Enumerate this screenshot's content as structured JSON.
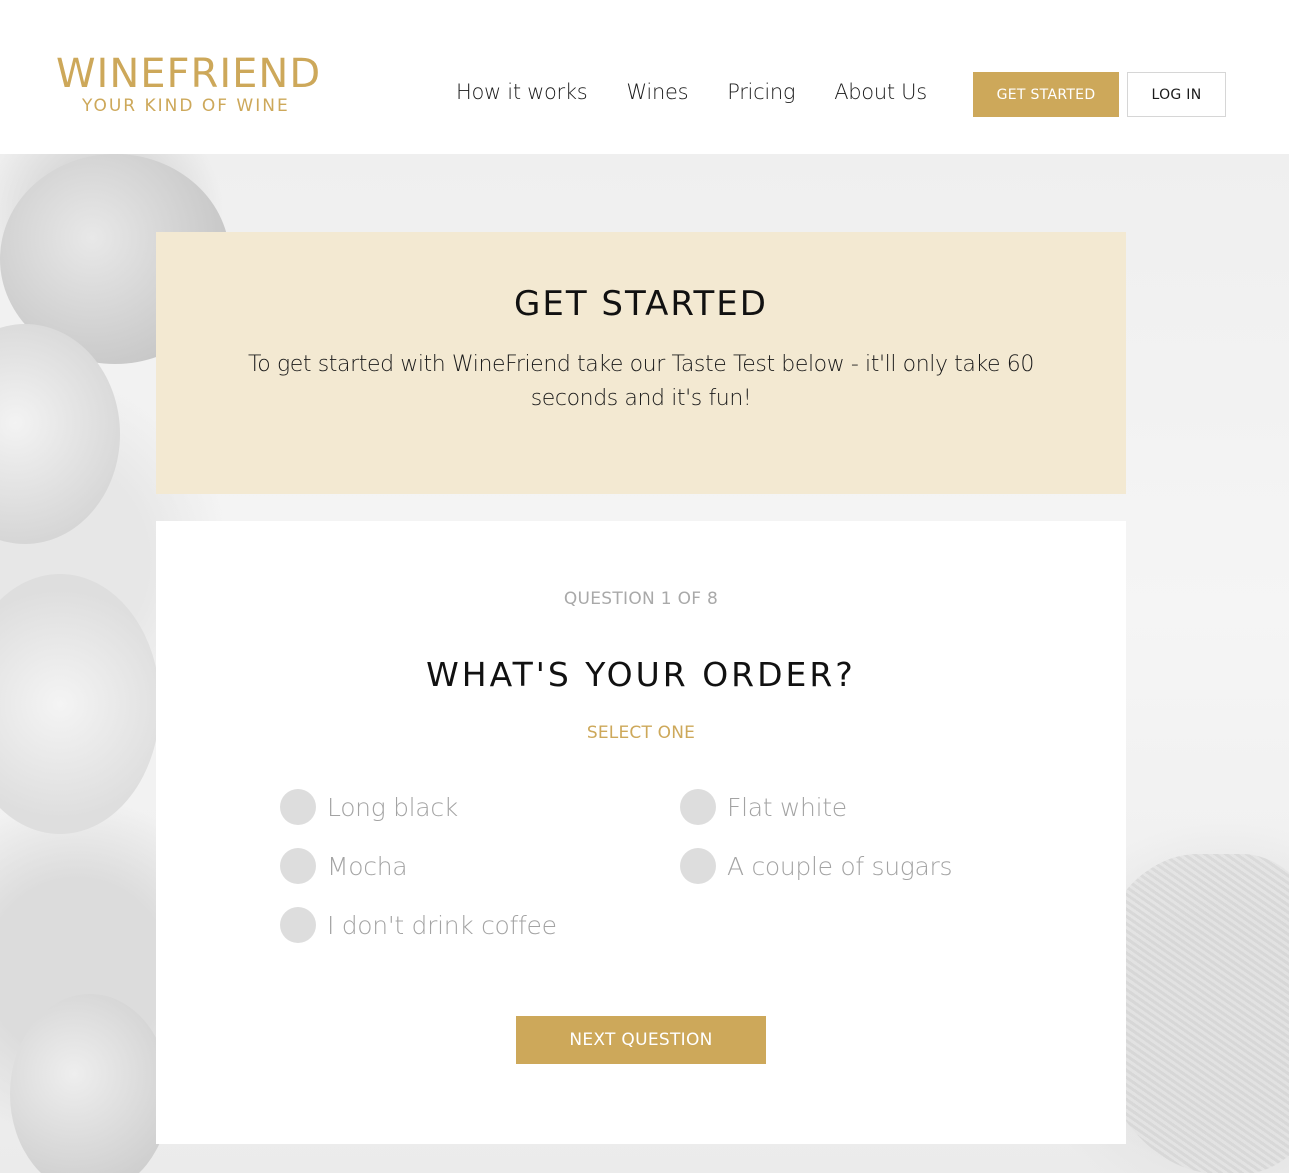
{
  "brand": {
    "name": "WINEFRIEND",
    "tagline": "YOUR KIND OF WINE",
    "accent_color": "#cda85a",
    "banner_color": "#f3e9d2"
  },
  "nav": {
    "items": [
      {
        "label": "How it works"
      },
      {
        "label": "Wines"
      },
      {
        "label": "Pricing"
      },
      {
        "label": "About Us"
      }
    ],
    "get_started_label": "GET STARTED",
    "login_label": "LOG IN"
  },
  "banner": {
    "title": "GET STARTED",
    "text": "To get started with WineFriend take our Taste Test below - it'll only take 60 seconds and it's fun!"
  },
  "quiz": {
    "progress_label": "QUESTION 1 OF 8",
    "current_question": 1,
    "total_questions": 8,
    "question": "WHAT'S YOUR ORDER?",
    "hint": "SELECT ONE",
    "options": [
      {
        "label": "Long black",
        "selected": false
      },
      {
        "label": "Flat white",
        "selected": false
      },
      {
        "label": "Mocha",
        "selected": false
      },
      {
        "label": "A couple of sugars",
        "selected": false
      },
      {
        "label": "I don't drink coffee",
        "selected": false
      }
    ],
    "next_label": "NEXT QUESTION"
  }
}
